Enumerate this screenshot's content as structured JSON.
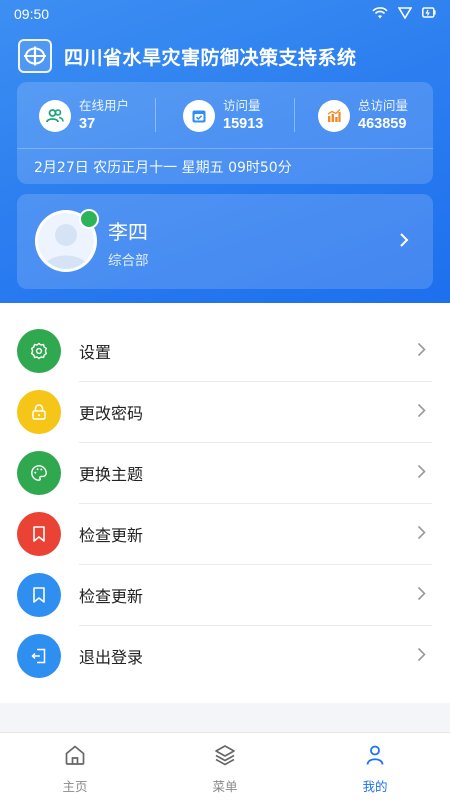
{
  "status_bar": {
    "time": "09:50"
  },
  "app": {
    "title": "四川省水旱灾害防御决策支持系统"
  },
  "stats": [
    {
      "label": "在线用户",
      "value": "37",
      "icon": "users-icon"
    },
    {
      "label": "访问量",
      "value": "15913",
      "icon": "calendar-icon"
    },
    {
      "label": "总访问量",
      "value": "463859",
      "icon": "bar-chart-icon"
    }
  ],
  "date_line": "2月27日  农历正月十一  星期五  09时50分",
  "user": {
    "name": "李四",
    "department": "综合部",
    "online": true
  },
  "menu": [
    {
      "label": "设置",
      "icon": "gear-icon",
      "color": "#2fa84f"
    },
    {
      "label": "更改密码",
      "icon": "lock-icon",
      "color": "#f5c518"
    },
    {
      "label": "更换主题",
      "icon": "palette-icon",
      "color": "#2fa84f"
    },
    {
      "label": "检查更新",
      "icon": "bookmark-icon",
      "color": "#ea4336"
    },
    {
      "label": "检查更新",
      "icon": "bookmark-icon",
      "color": "#2f8ff0"
    },
    {
      "label": "退出登录",
      "icon": "logout-icon",
      "color": "#2f8ff0"
    }
  ],
  "tabs": [
    {
      "label": "主页",
      "icon": "home-icon",
      "active": false
    },
    {
      "label": "菜单",
      "icon": "layers-icon",
      "active": false
    },
    {
      "label": "我的",
      "icon": "person-icon",
      "active": true
    }
  ],
  "colors": {
    "accent": "#1f73ee",
    "header": "#2d7ff0",
    "online": "#2fb35a"
  }
}
